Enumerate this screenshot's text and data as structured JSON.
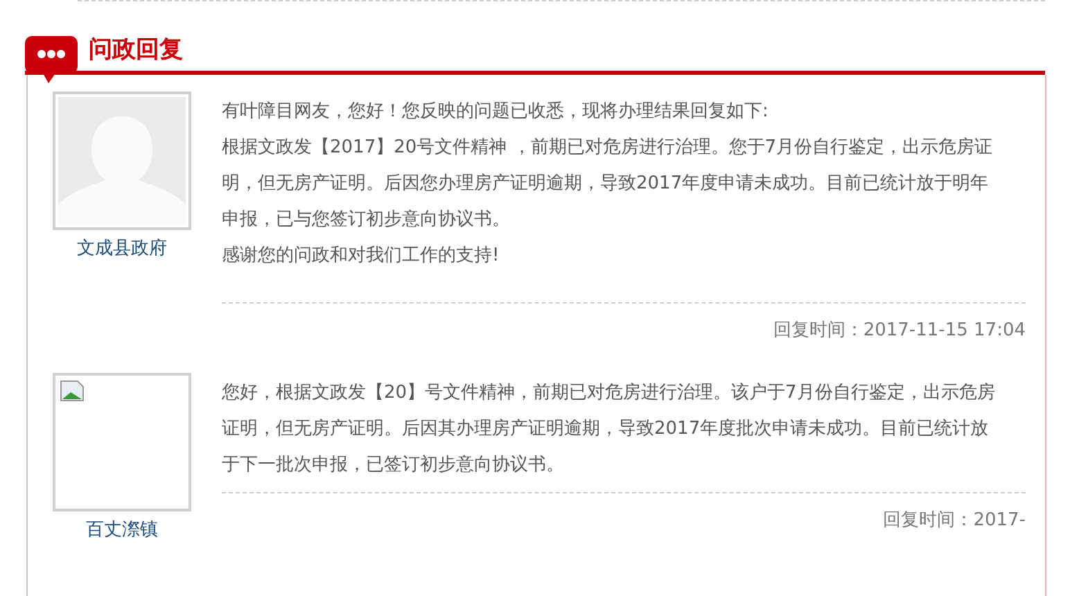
{
  "section": {
    "title": "问政回复"
  },
  "replies": [
    {
      "author": "文成县政府",
      "kind": "silhouette",
      "paragraphs": [
        "有叶障目网友，您好！您反映的问题已收悉，现将办理结果回复如下:",
        "根据文政发【2017】20号文件精神 ，前期已对危房进行治理。您于7月份自行鉴定，出示危房证明，但无房产证明。后因您办理房产证明逾期，导致2017年度申请未成功。目前已统计放于明年申报，已与您签订初步意向协议书。",
        "感谢您的问政和对我们工作的支持!"
      ],
      "time": "回复时间：2017-11-15 17:04"
    },
    {
      "author": "百丈漈镇",
      "kind": "broken",
      "paragraphs": [
        "您好，根据文政发【20】号文件精神，前期已对危房进行治理。该户于7月份自行鉴定，出示危房证明，但无房产证明。后因其办理房产证明逾期，导致2017年度批次申请未成功。目前已统计放于下一批次申报，已签订初步意向协议书。"
      ],
      "time": "回复时间：2017-"
    }
  ]
}
